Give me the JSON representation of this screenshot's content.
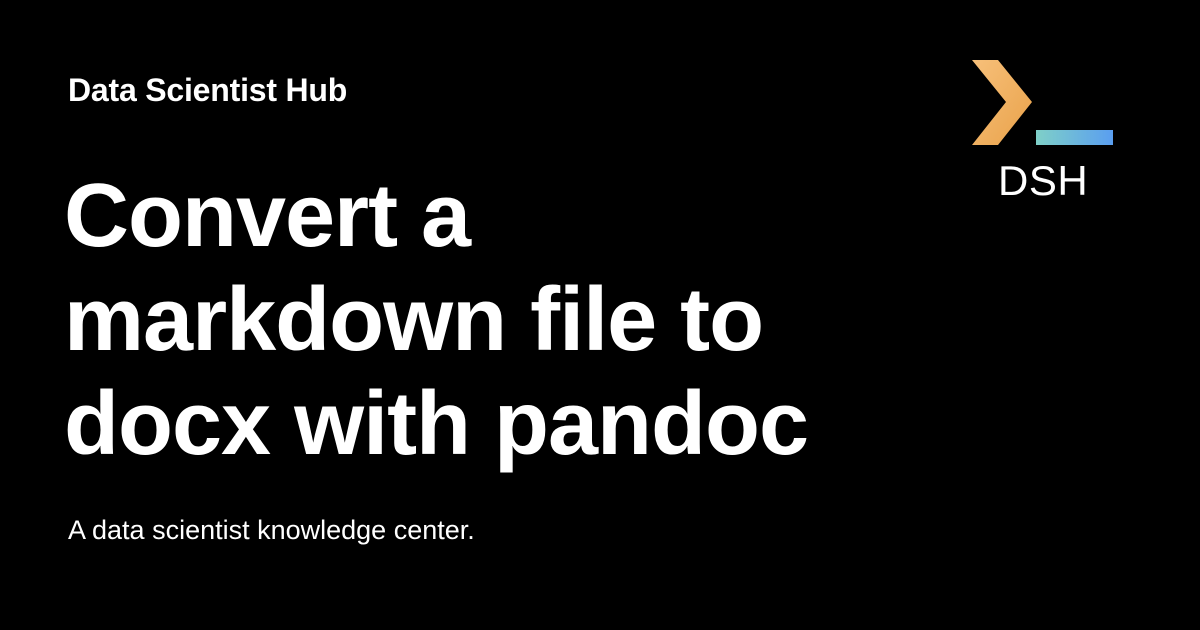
{
  "header": {
    "site_name": "Data Scientist Hub"
  },
  "main": {
    "title_lines": [
      "Convert a",
      "markdown file to",
      "docx with pandoc"
    ],
    "tagline": "A data scientist knowledge center."
  },
  "logo": {
    "text": "DSH",
    "icon": "terminal-prompt-icon",
    "colors": {
      "chevron_start": "#f7c07a",
      "chevron_end": "#e9a24a",
      "underscore_start": "#7fd0c8",
      "underscore_end": "#5a9ef0"
    }
  },
  "colors": {
    "background": "#000000",
    "text": "#ffffff"
  }
}
